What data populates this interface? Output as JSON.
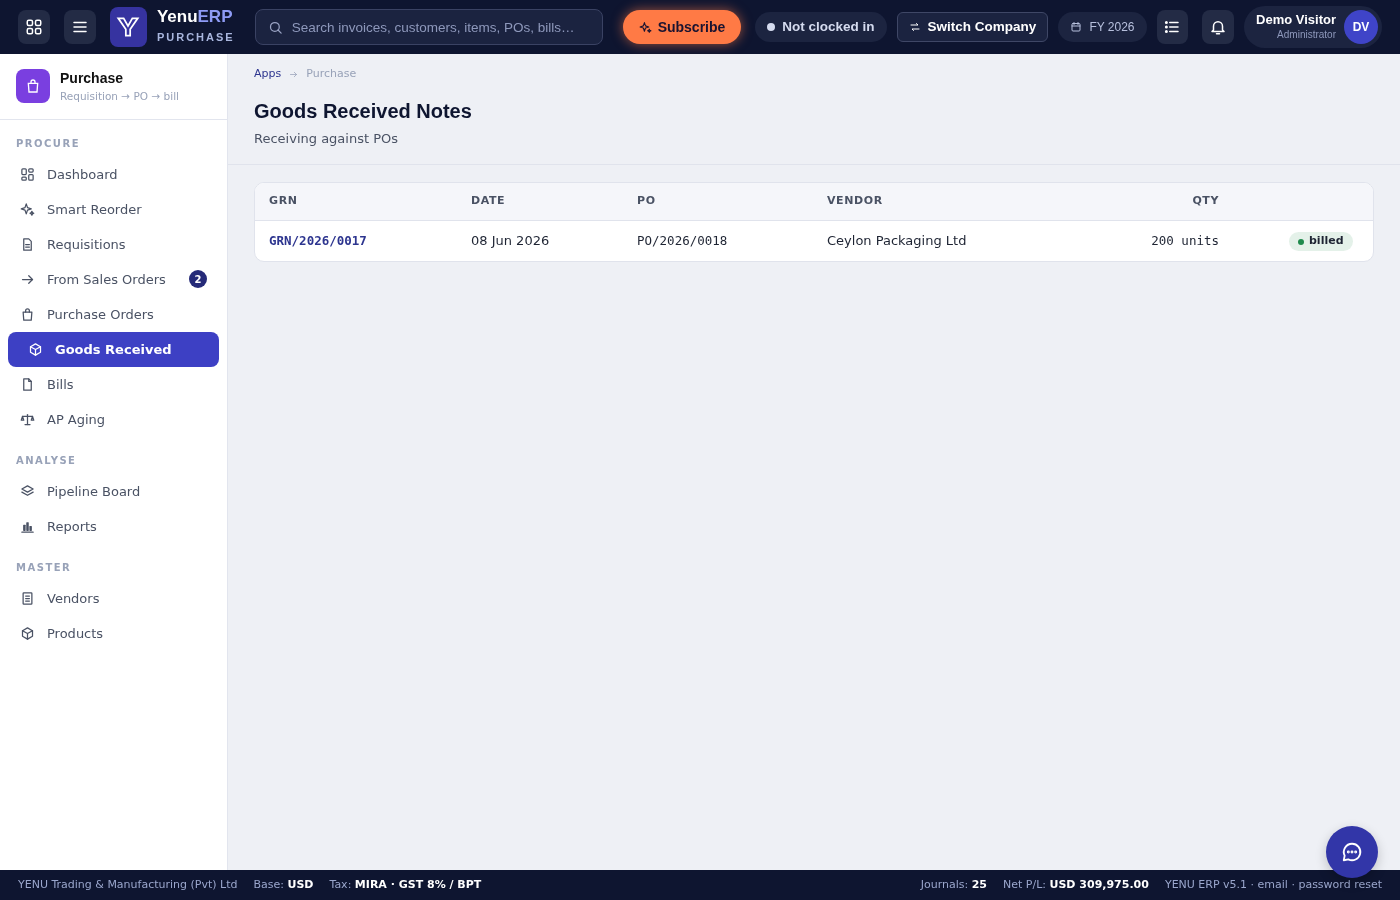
{
  "topbar": {
    "brand": {
      "name": "Yenu",
      "accent": "ERP",
      "module": "PURCHASE"
    },
    "search": {
      "placeholder": "Search invoices, customers, items, POs, bills…"
    },
    "subscribe": "Subscribe",
    "clock": "Not clocked in",
    "switch_company": "Switch  Company",
    "fiscal_year": "FY 2026",
    "user": {
      "name": "Demo Visitor",
      "role": "Administrator",
      "initials": "DV"
    }
  },
  "sidebar": {
    "module": {
      "title": "Purchase",
      "subtitle": "Requisition → PO → bill"
    },
    "sections": [
      {
        "title": "PROCURE",
        "items": [
          {
            "label": "Dashboard",
            "selected": false
          },
          {
            "label": "Smart Reorder",
            "selected": false
          },
          {
            "label": "Requisitions",
            "selected": false
          },
          {
            "label": "From Sales Orders",
            "selected": false,
            "badge": "2"
          },
          {
            "label": "Purchase Orders",
            "selected": false
          },
          {
            "label": "Goods Received",
            "selected": true
          },
          {
            "label": "Bills",
            "selected": false
          },
          {
            "label": "AP Aging",
            "selected": false
          }
        ]
      },
      {
        "title": "ANALYSE",
        "items": [
          {
            "label": "Pipeline Board",
            "selected": false
          },
          {
            "label": "Reports",
            "selected": false
          }
        ]
      },
      {
        "title": "MASTER",
        "items": [
          {
            "label": "Vendors",
            "selected": false
          },
          {
            "label": "Products",
            "selected": false
          }
        ]
      }
    ]
  },
  "breadcrumb": [
    "Apps",
    "Purchase"
  ],
  "page": {
    "title": "Goods Received Notes",
    "subtitle": "Receiving against POs"
  },
  "table": {
    "columns": [
      "GRN",
      "DATE",
      "PO",
      "VENDOR",
      "QTY"
    ],
    "rows": [
      {
        "grn": "GRN/2026/0017",
        "date": "08 Jun 2026",
        "po": "PO/2026/0018",
        "vendor": "Ceylon Packaging Ltd",
        "qty": "200 units",
        "status": "billed",
        "color": "#1f8a4c"
      }
    ]
  },
  "status_bar": {
    "left": [
      "YENU Trading & Manufacturing (Pvt) Ltd",
      "Base: **USD**",
      "Tax: **MIRA · GST 8% / BPT**"
    ],
    "right": [
      "Journals: **25**",
      "Net P/L: **USD 309,975.00**",
      "YENU ERP v5.1 · email · password reset"
    ]
  }
}
